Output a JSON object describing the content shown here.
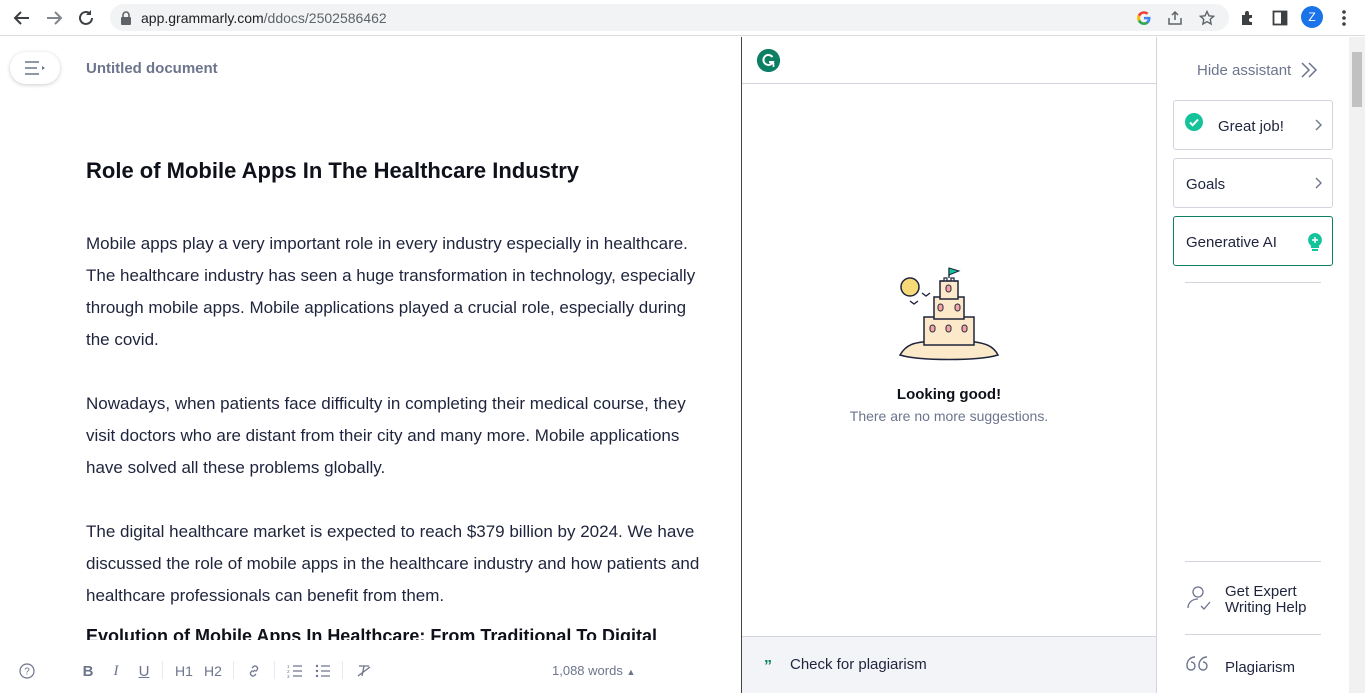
{
  "browser": {
    "url_host": "app.grammarly.com",
    "url_path": "/ddocs/2502586462",
    "profile_initial": "Z"
  },
  "editor": {
    "doc_title": "Untitled document",
    "heading": "Role of Mobile Apps In The Healthcare Industry",
    "paragraphs": [
      "Mobile apps play a very important role in every industry especially in healthcare. The healthcare industry has seen a huge transformation in technology, especially through mobile apps. Mobile applications played a crucial role, especially during the covid.",
      "Nowadays, when patients face difficulty in completing their medical course, they visit doctors who are distant from their city and many more. Mobile applications have solved all these problems globally.",
      "The digital healthcare market is expected to reach $379 billion by 2024. We have discussed the role of mobile apps in the healthcare industry and how patients and healthcare professionals can benefit from them."
    ],
    "subheading": "Evolution of Mobile Apps In Healthcare: From Traditional To Digital",
    "toolbar": {
      "bold": "B",
      "italic": "I",
      "underline": "U",
      "h1": "H1",
      "h2": "H2",
      "word_count": "1,088 words"
    }
  },
  "panel": {
    "empty_title": "Looking good!",
    "empty_subtitle": "There are no more suggestions.",
    "plagiarism_check": "Check for plagiarism"
  },
  "assistant": {
    "hide_label": "Hide assistant",
    "cards": {
      "great_job": "Great job!",
      "goals": "Goals",
      "generative_ai": "Generative AI"
    },
    "expert_help": "Get Expert Writing Help",
    "plagiarism": "Plagiarism"
  },
  "colors": {
    "brand_green": "#0d7f63",
    "success_green": "#15c39a"
  }
}
